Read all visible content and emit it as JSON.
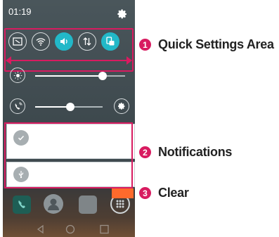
{
  "status_bar": {
    "time": "01:19"
  },
  "quick_settings": {
    "tiles": [
      {
        "name": "screen-capture-icon",
        "active": false
      },
      {
        "name": "wifi-icon",
        "active": false
      },
      {
        "name": "sound-icon",
        "active": true
      },
      {
        "name": "data-icon",
        "active": false
      },
      {
        "name": "rotation-icon",
        "active": true
      }
    ],
    "brightness_level": 0.75,
    "volume_level": 0.52
  },
  "callouts": [
    {
      "number": "1",
      "label": "Quick Settings Area"
    },
    {
      "number": "2",
      "label": "Notifications"
    },
    {
      "number": "3",
      "label": "Clear"
    }
  ],
  "colors": {
    "accent": "#d81b60",
    "tile_active": "#22b8c8",
    "clear_button": "#ff6a2c"
  }
}
